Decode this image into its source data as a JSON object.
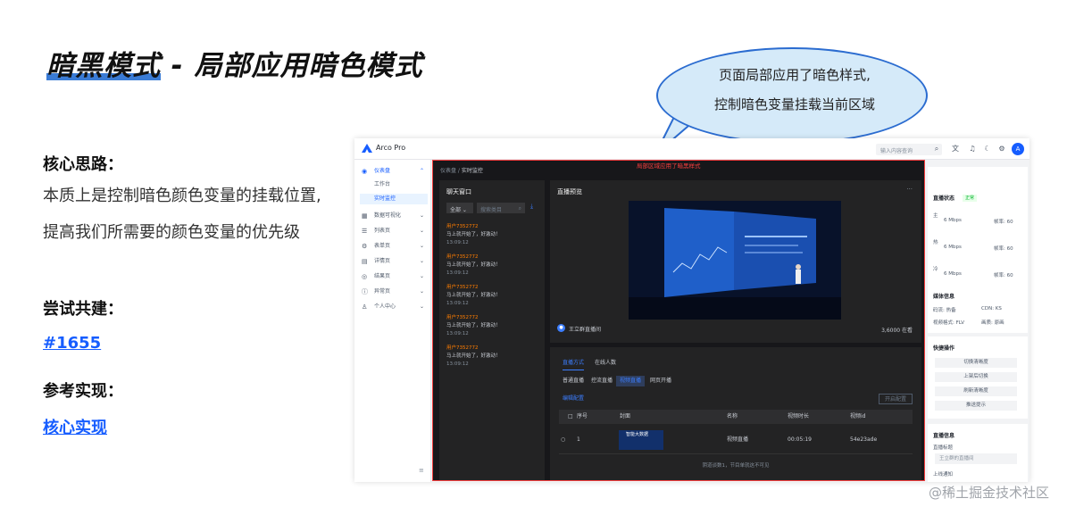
{
  "slide": {
    "title": "暗黑模式 - 局部应用暗色模式",
    "idea_heading": "核心思路：",
    "idea_line1": "本质上是控制暗色颜色变量的挂载位置,",
    "idea_line2": "提高我们所需要的颜色变量的优先级",
    "try_heading": "尝试共建：",
    "try_link": "#1655",
    "ref_heading": "参考实现：",
    "ref_link": "核心实现",
    "bubble_line1": "页面局部应用了暗色样式,",
    "bubble_line2": "控制暗色变量挂载当前区域",
    "watermark": "@稀土掘金技术社区"
  },
  "app": {
    "brand": "Arco Pro",
    "search_placeholder": "输入内容查询",
    "avatar": "A",
    "region_label": "局部区域应用了暗黑样式",
    "breadcrumb": [
      "仪表盘",
      "实时监控"
    ],
    "sidebar": {
      "dashboard": "仪表盘",
      "workplace": "工作台",
      "monitor": "实时监控",
      "visualization": "数据可视化",
      "list": "列表页",
      "form": "表单页",
      "profile": "详情页",
      "result": "结果页",
      "exception": "异常页",
      "user": "个人中心"
    },
    "chat": {
      "title": "聊天窗口",
      "select": "全部",
      "search_placeholder": "搜索类目",
      "messages": [
        {
          "user": "用户7352772",
          "text": "马上就开始了，好激动！",
          "time": "13:09:12"
        },
        {
          "user": "用户7352772",
          "text": "马上就开始了，好激动！",
          "time": "13:09:12"
        },
        {
          "user": "用户7352772",
          "text": "马上就开始了，好激动！",
          "time": "13:09:12"
        },
        {
          "user": "用户7352772",
          "text": "马上就开始了，好激动！",
          "time": "13:09:12"
        },
        {
          "user": "用户7352772",
          "text": "马上就开始了，好激动！",
          "time": "13:09:12"
        }
      ]
    },
    "preview": {
      "title": "直播预览",
      "more": "···",
      "host": "王立群直播间",
      "online": "3,6000 在看"
    },
    "lower": {
      "tabs": [
        "直播方式",
        "在线人数"
      ],
      "chips": [
        "普通直播",
        "控流直播",
        "视频直播",
        "网页开播"
      ],
      "edit": "编辑配置",
      "start": "开启配置",
      "columns": [
        "序号",
        "封面",
        "名称",
        "视频时长",
        "视频id"
      ],
      "row": {
        "index": "1",
        "name": "视频直播",
        "duration": "00:05:19",
        "id": "54e23ade",
        "thumb_text": "智能大数据"
      },
      "footer": "阴道谈数1，节目单就这不可见"
    },
    "right": {
      "status_title": "直播状态",
      "status_badge": "正常",
      "stats": [
        {
          "a": "主",
          "b": "6 Mbps",
          "c": "帧率: 60"
        },
        {
          "a": "热",
          "b": "6 Mbps",
          "c": "帧率: 60"
        },
        {
          "a": "冷",
          "b": "6 Mbps",
          "c": "帧率: 60"
        }
      ],
      "media_title": "媒体信息",
      "media_row1": [
        "码流: 热备",
        "CDN: KS"
      ],
      "media_row2": [
        "视频格式: FLV",
        "画质: 原画"
      ],
      "quick_title": "快捷操作",
      "quick_buttons": [
        "切换清晰度",
        "上架后切换",
        "刷新清晰度",
        "推送提示"
      ],
      "info_title": "直播信息",
      "info_label": "直播标题",
      "info_value": "王立群的直播间",
      "info_label2": "上线通知"
    }
  }
}
